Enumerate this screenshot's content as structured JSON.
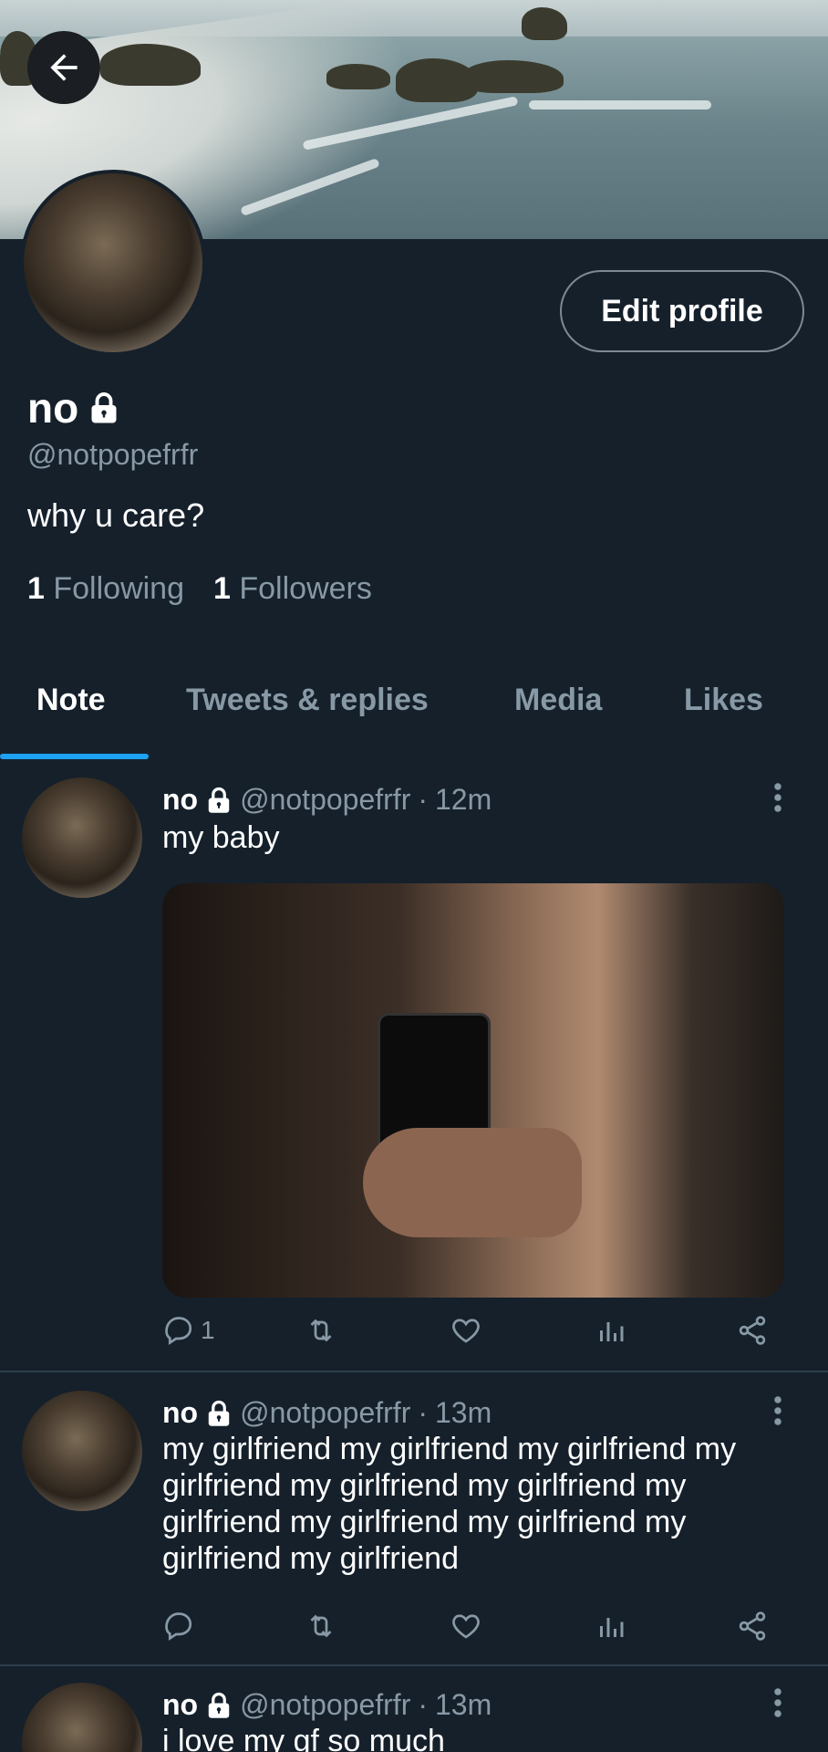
{
  "profile": {
    "name": "no",
    "handle": "@notpopefrfr",
    "bio": "why u care?",
    "following_count": "1",
    "following_label": "Following",
    "followers_count": "1",
    "followers_label": "Followers",
    "edit_label": "Edit profile"
  },
  "tabs": [
    {
      "label": "Note",
      "active": true
    },
    {
      "label": "Tweets & replies",
      "active": false
    },
    {
      "label": "Media",
      "active": false
    },
    {
      "label": "Likes",
      "active": false
    }
  ],
  "tweets": [
    {
      "name": "no",
      "handle": "@notpopefrfr",
      "time": "12m",
      "text": "my baby",
      "reply_count": "1",
      "has_media": true
    },
    {
      "name": "no",
      "handle": "@notpopefrfr",
      "time": "13m",
      "text": "my girlfriend my girlfriend  my girlfriend my girlfriend my girlfriend my girlfriend my girlfriend my girlfriend my girlfriend my girlfriend my girlfriend",
      "reply_count": "",
      "has_media": false
    },
    {
      "name": "no",
      "handle": "@notpopefrfr",
      "time": "13m",
      "text": "i love my gf so much",
      "reply_count": "",
      "has_media": false
    }
  ],
  "icons": {
    "back": "arrow-left-icon",
    "lock": "lock-icon",
    "reply": "reply-icon",
    "retweet": "retweet-icon",
    "like": "heart-icon",
    "stats": "stats-icon",
    "share": "share-icon",
    "more": "more-vertical-icon"
  },
  "colors": {
    "background": "#15202b",
    "accent": "#1da1f2",
    "muted": "#8899a6"
  }
}
